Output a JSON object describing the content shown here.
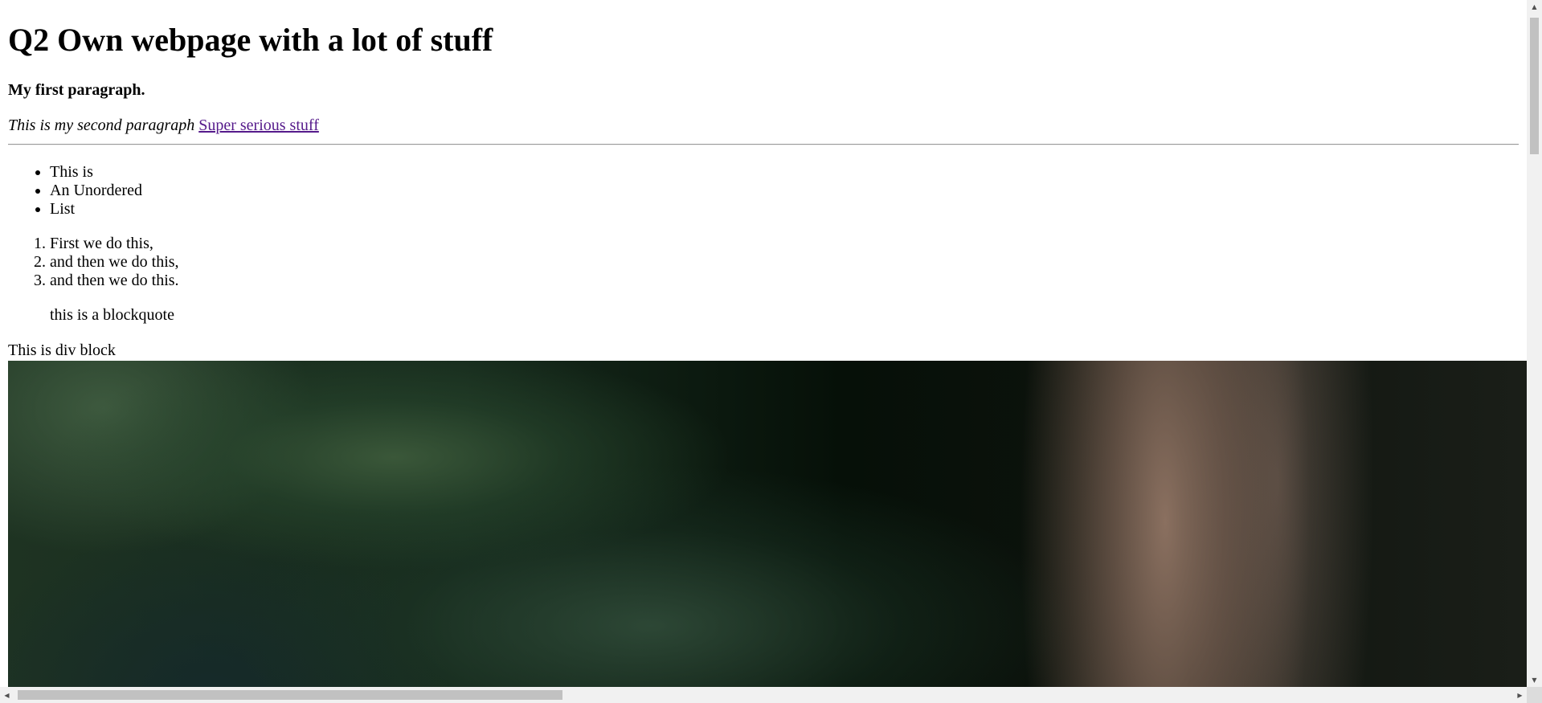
{
  "heading": "Q2 Own webpage with a lot of stuff",
  "paragraph_1": "My first paragraph.",
  "paragraph_2": {
    "italic_text": "This is my second paragraph",
    "link_text": "Super serious stuff"
  },
  "unordered_list": [
    "This is",
    "An Unordered",
    "List"
  ],
  "ordered_list": [
    "First we do this,",
    "and then we do this,",
    "and then we do this."
  ],
  "blockquote": "this is a blockquote",
  "div_block": "This is div block",
  "image": {
    "description_icon": "photo-image"
  },
  "scrollbars": {
    "up_arrow": "▲",
    "down_arrow": "▼",
    "left_arrow": "◀",
    "right_arrow": "▶"
  },
  "colors": {
    "visited_link": "#551a8b",
    "scrollbar_track": "#f1f1f1",
    "scrollbar_thumb": "#c1c1c1"
  }
}
